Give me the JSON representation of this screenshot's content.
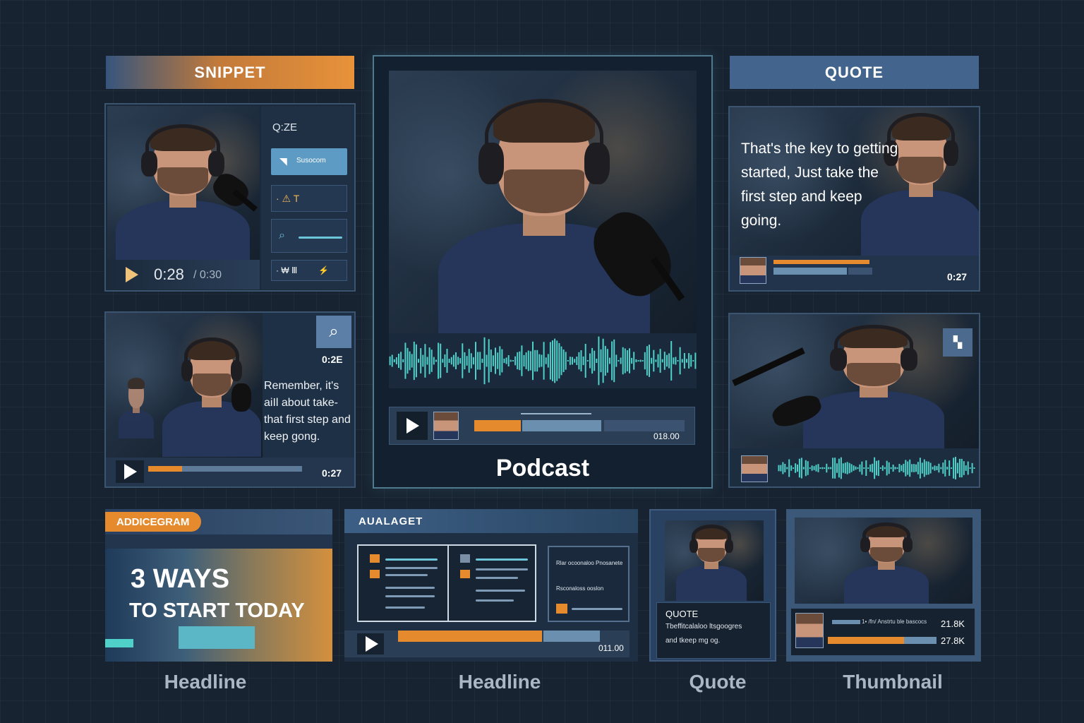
{
  "snippet": {
    "banner": "SNIPPET",
    "time_current": "0:28",
    "time_total": "/ 0:30",
    "side_time": "Q:ZE",
    "side_item1": "Susocom",
    "side_item2": "· ⚠ T",
    "side_item4": "· ₩ Ⅲ",
    "side_item4_right": "⚡"
  },
  "snippet2": {
    "time_top": "0:2E",
    "quote": "Remember, it's aiIl about take- that first step and keep gong.",
    "time": "0:27"
  },
  "podcast": {
    "time": "018.00",
    "label": "Podcast"
  },
  "quote_card": {
    "banner": "QUOTE",
    "text": "That's the key to getting started, Just take the first step and keep going.",
    "time": "0:27"
  },
  "audiogram": {
    "banner": "ADDICEGRAM",
    "headline_line1": "3 WAYS",
    "headline_line2": "TO START TODAY",
    "caption": "Headline"
  },
  "audiogram2": {
    "banner": "AUALAGET",
    "side_title": "Rlar ocoonaloo Pnosanete",
    "side_sub": "Rsconaloss ooslon",
    "time": "011.00",
    "caption": "Headline"
  },
  "small_quote": {
    "label": "QUOTE",
    "line1": "Tbeffitcalaloo ltsgoogres",
    "line2": "and tkeep mg og.",
    "caption": "Quote"
  },
  "thumbnail": {
    "stat1_text": "1• /fn/ Anstrtu ble bascocs",
    "stat1_value": "21.8K",
    "stat2_value": "27.8K",
    "caption": "Thumbnail"
  },
  "colors": {
    "accent_orange": "#e68a2e",
    "accent_teal": "#4fd0c8",
    "accent_blue": "#4f6f97",
    "background": "#182331"
  },
  "icons": [
    "play-icon",
    "magnifier-icon",
    "bookmark-icon",
    "checkbox-icon",
    "avatar-icon"
  ]
}
